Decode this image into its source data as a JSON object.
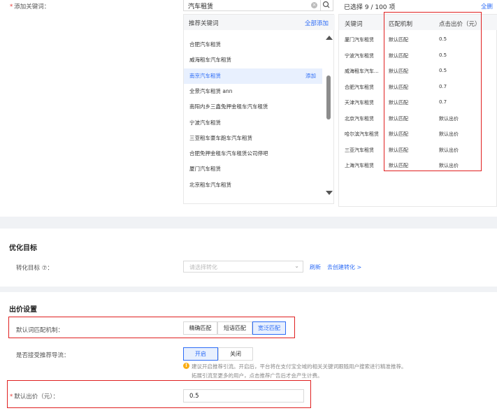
{
  "keywords": {
    "label": "添加关键词：",
    "search_value": "汽车租赁",
    "recommend_header": "推荐关键词",
    "add_all": "全部添加",
    "items": [
      {
        "text": "合肥汽车租赁",
        "add": ""
      },
      {
        "text": "威海租车汽车租赁",
        "add": ""
      },
      {
        "text": "南京汽车租赁",
        "add": "添加"
      },
      {
        "text": "全景汽车租赁 ann",
        "add": ""
      },
      {
        "text": "南阳内乡三鑫兔押金租车汽车租赁",
        "add": ""
      },
      {
        "text": "宁波汽车租赁",
        "add": ""
      },
      {
        "text": "三亚租车豪车跑车汽车租赁",
        "add": ""
      },
      {
        "text": "合肥免押金租车汽车租赁公司停吧",
        "add": ""
      },
      {
        "text": "厦门汽车租赁",
        "add": ""
      },
      {
        "text": "北京租车汽车租赁",
        "add": ""
      }
    ],
    "selected_title": "已选择 9 / 100 项",
    "clear_all": "全删",
    "columns": [
      "关键词",
      "匹配机制",
      "点击出价（元）"
    ],
    "rows": [
      [
        "厦门汽车租赁",
        "默认匹配",
        "0.5"
      ],
      [
        "宁波汽车租赁",
        "默认匹配",
        "0.5"
      ],
      [
        "威海租车汽车...",
        "默认匹配",
        "0.5"
      ],
      [
        "合肥汽车租赁",
        "默认匹配",
        "0.7"
      ],
      [
        "天津汽车租赁",
        "默认匹配",
        "0.7"
      ],
      [
        "北京汽车租赁",
        "默认匹配",
        "默认出价"
      ],
      [
        "哈尔滨汽车租赁",
        "默认匹配",
        "默认出价"
      ],
      [
        "三亚汽车租赁",
        "默认匹配",
        "默认出价"
      ],
      [
        "上海汽车租赁",
        "默认匹配",
        "默认出价"
      ]
    ]
  },
  "optimize": {
    "title": "优化目标",
    "label": "转化目标 ⑦：",
    "placeholder": "请选择转化",
    "refresh": "刷新",
    "create": "去创建转化 >"
  },
  "bid": {
    "title": "出价设置",
    "match_label": "默认词匹配机制：",
    "match_options": [
      "精确匹配",
      "短语匹配",
      "宽泛匹配"
    ],
    "match_active": 2,
    "recommend_label": "是否接受推荐导流：",
    "toggle_options": [
      "开启",
      "关闭"
    ],
    "hint1": "建议开启推荐引流。开启后，平台将在支付宝全域的相关关键词跟随用户搜索进行精准推荐。",
    "hint2": "拓展引流至更多的用户，点击推荐广告后才会产生计费。",
    "default_bid_label": "默认出价（元）：",
    "default_bid_value": "0.5"
  }
}
